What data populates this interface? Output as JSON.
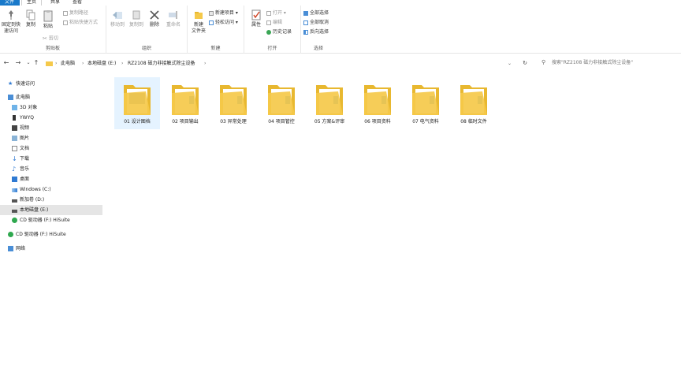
{
  "tabs": [
    "文件",
    "主页",
    "共享",
    "查看"
  ],
  "ribbon": {
    "clipboard": {
      "pin_label": "固定到快\n速访问",
      "copy_label": "复制",
      "paste_label": "粘贴",
      "copy_path": "复制路径",
      "paste_shortcut": "粘贴快捷方式",
      "cut": "剪切",
      "group_label": "剪贴板"
    },
    "organize": {
      "move_to": "移动到",
      "copy_to": "复制到",
      "delete": "删除",
      "rename": "重命名",
      "group_label": "组织"
    },
    "new": {
      "new_folder": "新建\n文件夹",
      "new_item": "新建项目",
      "easy_access": "轻松访问",
      "group_label": "新建"
    },
    "open": {
      "properties": "属性",
      "open": "打开",
      "edit": "编辑",
      "history": "历史记录",
      "group_label": "打开"
    },
    "select": {
      "select_all": "全部选择",
      "select_none": "全部取消",
      "invert": "反向选择",
      "group_label": "选择"
    }
  },
  "nav": {
    "breadcrumb": [
      "此电脑",
      "本地磁盘 (E:)",
      "RZ2108 磁力非接触式除尘设备"
    ],
    "search_placeholder": "搜索\"RZ2108 磁力非接触式除尘设备\""
  },
  "sidebar": [
    {
      "label": "快速访问",
      "icon": "star-icon",
      "level": 0
    },
    {
      "label": "此电脑",
      "icon": "computer-icon",
      "level": 0
    },
    {
      "label": "3D 对象",
      "icon": "cube-icon",
      "level": 1
    },
    {
      "label": "YWYQ",
      "icon": "phone-icon",
      "level": 1
    },
    {
      "label": "视频",
      "icon": "video-icon",
      "level": 1
    },
    {
      "label": "图片",
      "icon": "picture-icon",
      "level": 1
    },
    {
      "label": "文档",
      "icon": "document-icon",
      "level": 1
    },
    {
      "label": "下载",
      "icon": "download-icon",
      "level": 1
    },
    {
      "label": "音乐",
      "icon": "music-icon",
      "level": 1
    },
    {
      "label": "桌面",
      "icon": "desktop-icon",
      "level": 1
    },
    {
      "label": "Windows (C:)",
      "icon": "drive-icon",
      "level": 1
    },
    {
      "label": "新加卷 (D:)",
      "icon": "drive-icon",
      "level": 1
    },
    {
      "label": "本地磁盘 (E:)",
      "icon": "drive-icon",
      "level": 1
    },
    {
      "label": "CD 驱动器 (F:) HiSuite",
      "icon": "cd-icon",
      "level": 1
    },
    {
      "label": "CD 驱动器 (F:) HiSuite",
      "icon": "cd-icon",
      "level": 0
    },
    {
      "label": "网络",
      "icon": "network-icon",
      "level": 0
    }
  ],
  "folders": [
    "01 设计图档",
    "02 项目输出",
    "03 异常处理",
    "04 项目管控",
    "05 方案&评审",
    "06 项目资料",
    "07 电气资料",
    "08 临时文件"
  ],
  "colors": {
    "file_tab": "#1979ca",
    "folder": "#f5c94a",
    "selected": "#e5e5e5",
    "hover": "#e5f3ff"
  }
}
